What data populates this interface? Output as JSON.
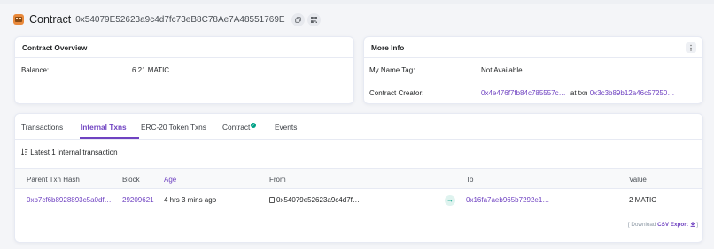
{
  "header": {
    "title": "Contract",
    "address": "0x54079E52623a9c4d7fc73eB8C78Ae7A48551769E",
    "copy_icon": "copy-icon",
    "qr_icon": "qr-code-icon"
  },
  "overview": {
    "title": "Contract Overview",
    "balance_label": "Balance:",
    "balance_value": "6.21 MATIC"
  },
  "more_info": {
    "title": "More Info",
    "menu_glyph": "⋮",
    "name_tag_label": "My Name Tag:",
    "name_tag_value": "Not Available",
    "creator_label": "Contract Creator:",
    "creator_address": "0x4e476f7fb84c785557c…",
    "at_txn": "at txn",
    "creator_txn": "0x3c3b89b12a46c57250…"
  },
  "tabs": {
    "transactions": "Transactions",
    "internal": "Internal Txns",
    "erc20": "ERC-20 Token Txns",
    "contract": "Contract",
    "events": "Events",
    "active": "Internal Txns"
  },
  "table": {
    "summary": "Latest 1 internal transaction",
    "headers": {
      "parent": "Parent Txn Hash",
      "block": "Block",
      "age": "Age",
      "from": "From",
      "to": "To",
      "value": "Value"
    },
    "rows": [
      {
        "parent": "0xb7cf6b8928893c5a0df…",
        "block": "29209621",
        "age": "4 hrs 3 mins ago",
        "from": "0x54079e52623a9c4d7f…",
        "to": "0x16fa7aeb965b7292e1…",
        "value": "2 MATIC"
      }
    ],
    "download_prefix": "[ Download",
    "download_link": "CSV Export",
    "download_suffix": "]"
  },
  "colors": {
    "accent": "#6f42c1",
    "success": "#00a186",
    "background": "#f4f5f8"
  }
}
